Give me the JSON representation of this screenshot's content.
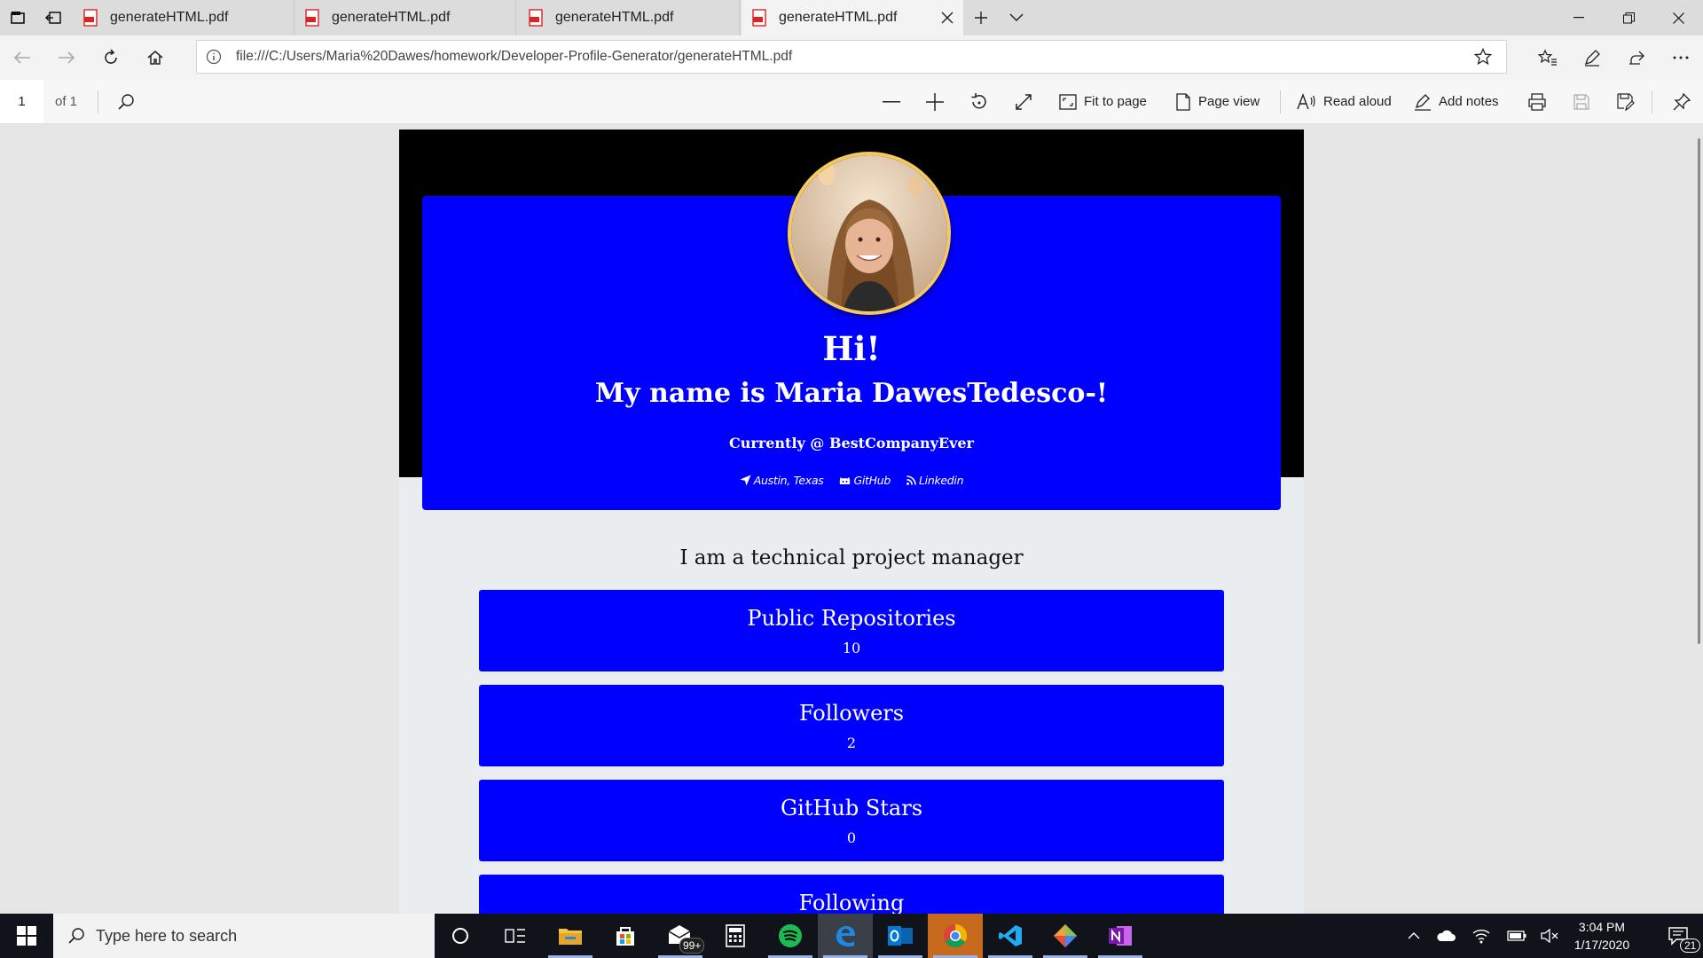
{
  "browser": {
    "tabs": [
      {
        "title": "generateHTML.pdf",
        "active": false
      },
      {
        "title": "generateHTML.pdf",
        "active": false
      },
      {
        "title": "generateHTML.pdf",
        "active": false
      },
      {
        "title": "generateHTML.pdf",
        "active": true
      }
    ],
    "url": "file:///C:/Users/Maria%20Dawes/homework/Developer-Profile-Generator/generateHTML.pdf"
  },
  "pdf_toolbar": {
    "page_number": "1",
    "page_of": "of 1",
    "fit_to_page": "Fit to page",
    "page_view": "Page view",
    "read_aloud": "Read aloud",
    "add_notes": "Add notes"
  },
  "profile": {
    "greeting": "Hi!",
    "name_line": "My name is Maria DawesTedesco-!",
    "company": "Currently @ BestCompanyEver",
    "links": {
      "location": "Austin, Texas",
      "github": "GitHub",
      "linkedin": "Linkedin"
    },
    "bio": "I am a technical project manager",
    "accent": "#0000ff",
    "stats": [
      {
        "label": "Public Repositories",
        "value": "10"
      },
      {
        "label": "Followers",
        "value": "2"
      },
      {
        "label": "GitHub Stars",
        "value": "0"
      },
      {
        "label": "Following",
        "value": ""
      }
    ]
  },
  "taskbar": {
    "search_placeholder": "Type here to search",
    "mail_badge": "99+",
    "apps": [
      "cortana-icon",
      "task-view-icon",
      "file-explorer-icon",
      "store-icon",
      "mail-icon",
      "calculator-icon",
      "spotify-icon",
      "edge-icon",
      "outlook-icon",
      "chrome-icon",
      "vscode-icon",
      "git-icon",
      "onenote-icon"
    ],
    "time": "3:04 PM",
    "date": "1/17/2020",
    "notifications": "21"
  }
}
